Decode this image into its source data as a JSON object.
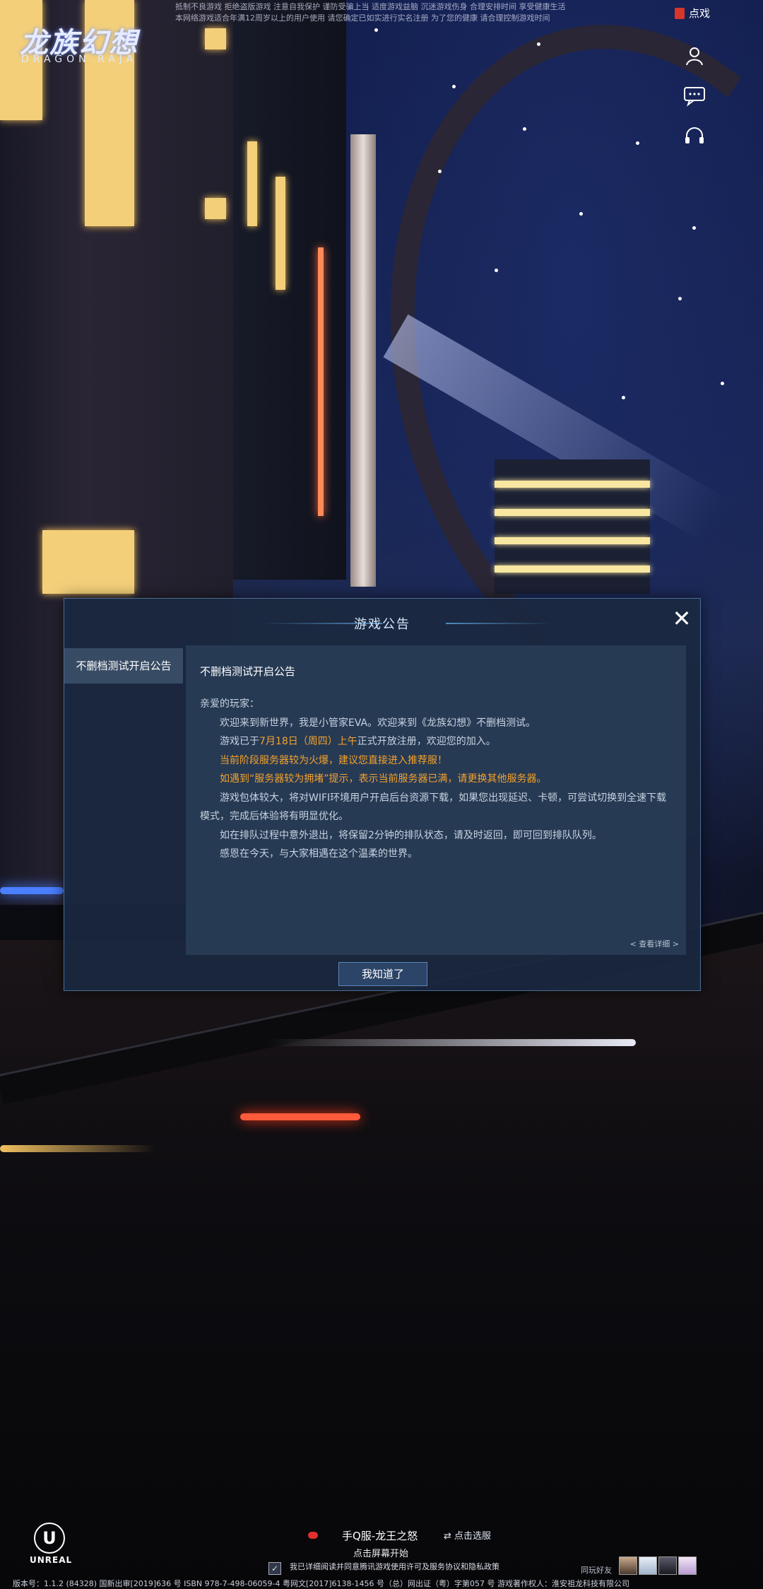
{
  "colors": {
    "highlight": "#f3a22c",
    "dialog_bg": "#1a2840",
    "button_bg": "#2b4468"
  },
  "top_notice": {
    "line1": "抵制不良游戏 拒绝盗版游戏 注意自我保护 谨防受骗上当 适度游戏益脑 沉迷游戏伤身 合理安排时间 享受健康生活",
    "line2": "本网络游戏适合年满12周岁以上的用户使用   请您确定已如实进行实名注册   为了您的健康   请合理控制游戏时间"
  },
  "logo": {
    "title": "龙族幻想",
    "subtitle": "DRAGON RAJA"
  },
  "header": {
    "dianxi_icon": "dianxi-icon",
    "dianxi_label": "点戏"
  },
  "side_icons": [
    "user-icon",
    "chat-icon",
    "headset-icon"
  ],
  "dialog": {
    "title": "游戏公告",
    "close_icon": "close-icon",
    "tab_label": "不删档测试开启公告",
    "content_title": "不删档测试开启公告",
    "greeting": "亲爱的玩家：",
    "p1": "欢迎来到新世界，我是小管家EVA。欢迎来到《龙族幻想》不删档测试。",
    "p2_prefix": "游戏已于",
    "p2_date": "7月18日（周四）上午",
    "p2_suffix": "正式开放注册，欢迎您的加入。",
    "p3": "当前阶段服务器较为火爆，建议您直接进入推荐服！",
    "p4": "如遇到“服务器较为拥堵”提示，表示当前服务器已满，请更换其他服务器。",
    "p5": "游戏包体较大，将对WIFI环境用户开启后台资源下载，如果您出现延迟、卡顿，可尝试切换到全速下载模式，完成后体验将有明显优化。",
    "p6": "如在排队过程中意外退出，将保留2分钟的排队状态，请及时返回，即可回到排队队列。",
    "p7": "感恩在今天，与大家相遇在这个温柔的世界。",
    "detail_link": "< 查看详细 >",
    "ok_button": "我知道了"
  },
  "bottom": {
    "engine_logo": "U",
    "engine_name": "UNREAL",
    "server_name": "手Q服-龙王之怒",
    "select_server": "⇄ 点击选服",
    "tap_start": "点击屏幕开始",
    "agree_check": "✓",
    "agree_text": "我已详细阅读并同意腾讯游戏使用许可及服务协议和隐私政策",
    "friends_label": "同玩好友",
    "footer": "版本号：1.1.2 (84328)      国新出审[2019]636 号  ISBN 978-7-498-06059-4  粤网文[2017]6138-1456 号（总）网出证（粤）字第057 号  游戏著作权人：淮安祖龙科技有限公司"
  }
}
